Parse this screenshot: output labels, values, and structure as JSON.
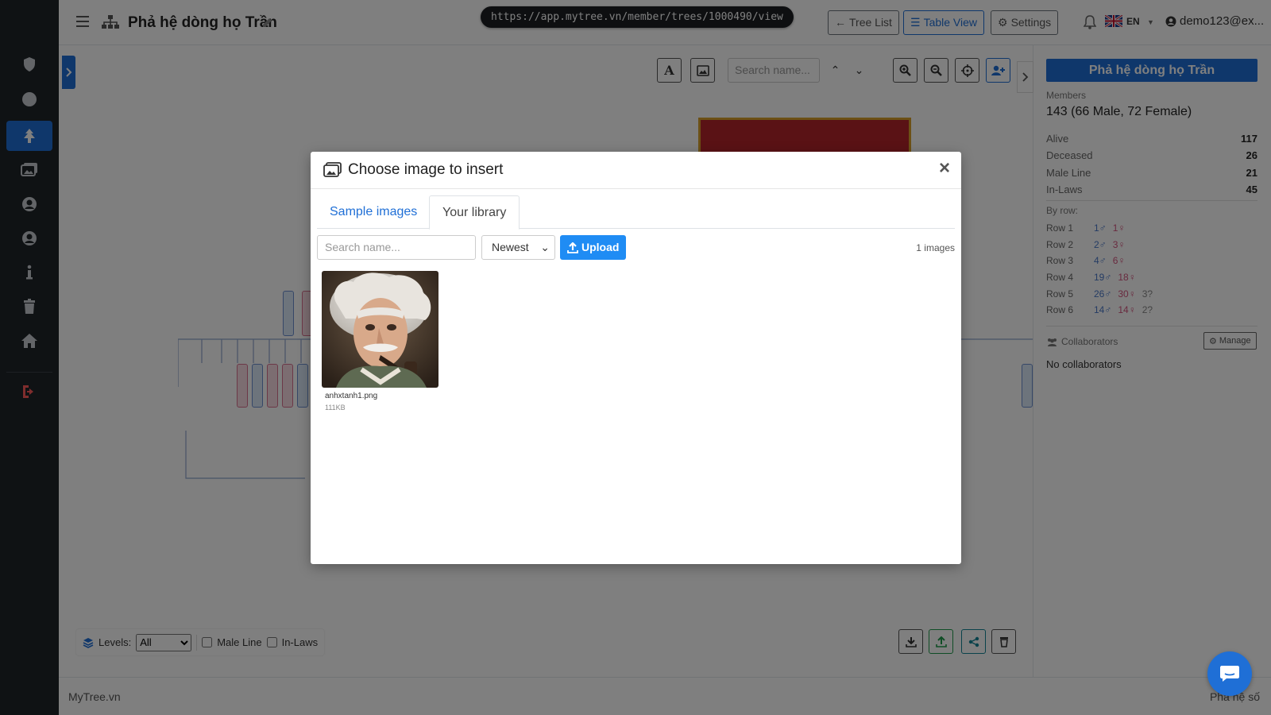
{
  "app": {
    "title": "Phả hệ dòng họ Trần",
    "url": "https://app.mytree.vn/member/trees/1000490/view"
  },
  "topbar": {
    "tree_list": "Tree List",
    "table_view": "Table View",
    "settings": "Settings",
    "language": "EN",
    "user": "demo123@ex..."
  },
  "canvas": {
    "search_placeholder": "Search name...",
    "levels_label": "Levels:",
    "levels_value": "All",
    "male_line": "Male Line",
    "in_laws": "In-Laws"
  },
  "right_panel": {
    "title": "Phả hệ dòng họ Trần",
    "members_label": "Members",
    "members_value": "143 (66 Male, 72 Female)",
    "stats": [
      {
        "label": "Alive",
        "value": "117"
      },
      {
        "label": "Deceased",
        "value": "26"
      },
      {
        "label": "Male Line",
        "value": "21"
      },
      {
        "label": "In-Laws",
        "value": "45"
      }
    ],
    "by_row_label": "By row:",
    "rows": [
      {
        "label": "Row 1",
        "male": "1♂",
        "female": "1♀",
        "unknown": ""
      },
      {
        "label": "Row 2",
        "male": "2♂",
        "female": "3♀",
        "unknown": ""
      },
      {
        "label": "Row 3",
        "male": "4♂",
        "female": "6♀",
        "unknown": ""
      },
      {
        "label": "Row 4",
        "male": "19♂",
        "female": "18♀",
        "unknown": ""
      },
      {
        "label": "Row 5",
        "male": "26♂",
        "female": "30♀",
        "unknown": "3?"
      },
      {
        "label": "Row 6",
        "male": "14♂",
        "female": "14♀",
        "unknown": "2?"
      }
    ],
    "collaborators_label": "Collaborators",
    "manage": "Manage",
    "no_collaborators": "No collaborators"
  },
  "footer": {
    "left": "MyTree.vn",
    "right": "Phả hệ số"
  },
  "modal": {
    "title": "Choose image to insert",
    "close": "×",
    "tabs": [
      "Sample images",
      "Your library"
    ],
    "active_tab": "Your library",
    "search_placeholder": "Search name...",
    "sort_value": "Newest",
    "upload": "Upload",
    "count": "1 images",
    "images": [
      {
        "name": "anhxtanh1.png",
        "size": "111KB"
      }
    ]
  },
  "colors": {
    "primary": "#1f6fd6",
    "sidebar": "#1f2429",
    "male": "#4a78c8",
    "female": "#d2557e"
  }
}
